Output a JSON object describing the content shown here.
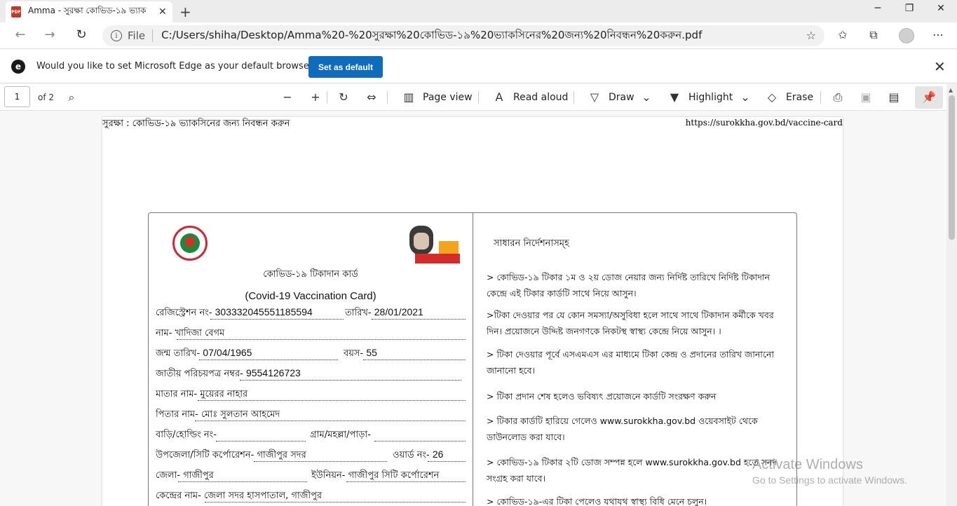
{
  "tab": {
    "title": "Amma - সুরক্ষা কোভিড-১৯ ভ্যাক",
    "badge": "PDF"
  },
  "address": {
    "scheme": "File",
    "url": "C:/Users/shiha/Desktop/Amma%20-%20সুরক্ষা%20কোভিড-১৯%20ভ্যাকসিনের%20জন্য%20নিবন্ধন%20করুন.pdf"
  },
  "infobar": {
    "message": "Would you like to set Microsoft Edge as your default browser?",
    "button": "Set as default"
  },
  "pdf_toolbar": {
    "page_value": "1",
    "page_count": "of 2",
    "page_view": "Page view",
    "read_aloud": "Read aloud",
    "draw": "Draw",
    "highlight": "Highlight",
    "erase": "Erase"
  },
  "doc": {
    "header_left": "সুরক্ষা : কোভিড-১৯ ভ্যাকসিনের জন্য নিবন্ধন করুন",
    "header_right": "https://surokkha.gov.bd/vaccine-card",
    "card_title_bn": "কোভিড-১৯ টিকাদান কার্ড",
    "card_title_en": "(Covid-19 Vaccination Card)",
    "reg_label": "রেজিস্ট্রেশন নং-",
    "reg_value": "303332045551185594",
    "date_label": "তারিখ-",
    "date_value": "28/01/2021",
    "name_label": "নাম-",
    "name_value": "খাদিজা বেগম",
    "dob_label": "জন্ম তারিখ-",
    "dob_value": "07/04/1965",
    "age_label": "বয়স-",
    "age_value": "55",
    "nid_label": "জাতীয় পরিচয়পত্র নম্বর-",
    "nid_value": "9554126723",
    "mother_label": "মাতার নাম-",
    "mother_value": "মুয়েরর নাহার",
    "father_label": "পিতার নাম-",
    "father_value": "মোঃ সুলতান আহমেদ",
    "house_label": "বাড়ি/হোল্ডিং নং-",
    "village_label": "গ্রাম/মহল্লা/পাড়া-",
    "upazila_label": "উপজেলা/সিটি কর্পোরেশন-",
    "upazila_value": "গাজীপুর সদর",
    "ward_label": "ওয়ার্ড নং-",
    "ward_value": "26",
    "district_label": "জেলা-",
    "district_value": "গাজীপুর",
    "union_label": "ইউনিয়ন-",
    "union_value": "গাজীপুর সিটি কর্পোরেশন",
    "center_label": "কেন্দ্রের নাম-",
    "center_value": "জেলা সদর হাসপাতাল, গাজীপুর",
    "guide_title": "সাধারন নির্দেশনাসম্‌হ",
    "guidelines": [
      "> কোভিড-১৯ টিকার ১ম ও ২য় ডোজ নেয়ার জন্য নির্দিষ্ট তারিখে নির্দিষ্ট টিকাদান কেন্দ্রে এই টিকার কার্ডটি সাথে নিয়ে আসুন।",
      ">টিকা দেওয়ার পর যে কোন সমস্যা/অসুবিধা হলে সাথে সাথে টিকাদান কর্মীকে খবর দিন। প্রয়োজনে উদ্দিষ্ট জনগণকে নিকটস্থ স্বাস্থ্য কেন্দ্রে নিয়ে আসুন। ।",
      "> টিকা দেওয়ার পূর্বে এসএমএস এর মাধ্যমে টিকা কেন্দ্র ও প্রদানের তারিখ জানানো জানানো হবে।",
      "> টিকা প্রদান শেষ হলেও ভবিষ্যৎ প্রয়োজনে কার্ডটি সংরক্ষণ করুন",
      "> টিকার কার্ডটি হারিয়ে গেলেও www.surokkha.gov.bd ওয়েবসাইট থেকে ডাউনলোড করা যাবে।",
      "> কোভিড-১৯ টিকার ২টি ডোজ সম্পন্ন হলে www.surokkha.gov.bd হতে সনদ সংগ্রহ করা যাবে।",
      "> কোভিড-১৯-এর টিকা পেলেও যথাযথ স্বাস্থ্য বিধি মেনে চলুন।"
    ]
  },
  "watermark": {
    "line1": "Activate Windows",
    "line2": "Go to Settings to activate Windows."
  }
}
